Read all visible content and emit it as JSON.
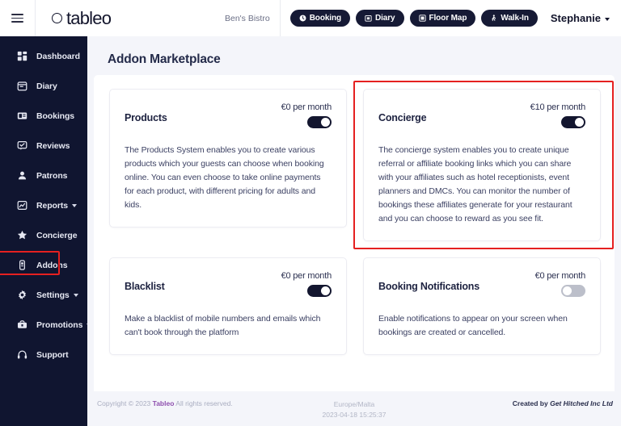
{
  "topbar": {
    "menu_icon": "hamburger-icon",
    "brand": "tableo",
    "venue": "Ben's Bistro",
    "actions": [
      {
        "label": "Booking",
        "icon": "clock-icon"
      },
      {
        "label": "Diary",
        "icon": "calendar-icon"
      },
      {
        "label": "Floor Map",
        "icon": "map-icon"
      },
      {
        "label": "Walk-In",
        "icon": "walking-icon"
      }
    ],
    "user": "Stephanie"
  },
  "sidebar": {
    "items": [
      {
        "label": "Dashboard",
        "icon": "dashboard-icon",
        "caret": false,
        "highlight": false
      },
      {
        "label": "Diary",
        "icon": "calendar-icon",
        "caret": false,
        "highlight": false
      },
      {
        "label": "Bookings",
        "icon": "bookings-icon",
        "caret": false,
        "highlight": false
      },
      {
        "label": "Reviews",
        "icon": "reviews-icon",
        "caret": false,
        "highlight": false
      },
      {
        "label": "Patrons",
        "icon": "patrons-icon",
        "caret": false,
        "highlight": false
      },
      {
        "label": "Reports",
        "icon": "reports-icon",
        "caret": true,
        "highlight": false
      },
      {
        "label": "Concierge",
        "icon": "star-icon",
        "caret": false,
        "highlight": false
      },
      {
        "label": "Addons",
        "icon": "addons-icon",
        "caret": false,
        "highlight": true
      },
      {
        "label": "Settings",
        "icon": "gear-icon",
        "caret": true,
        "highlight": false
      },
      {
        "label": "Promotions",
        "icon": "promotions-icon",
        "caret": true,
        "highlight": false
      },
      {
        "label": "Support",
        "icon": "headset-icon",
        "caret": false,
        "highlight": false
      }
    ]
  },
  "main": {
    "page_title": "Addon Marketplace",
    "cards": [
      {
        "title": "Products",
        "price": "€0 per month",
        "toggle": "on",
        "description": "The Products System enables you to create various products which your guests can choose when booking online. You can even choose to take online payments for each product, with different pricing for adults and kids.",
        "highlight": false
      },
      {
        "title": "Concierge",
        "price": "€10 per month",
        "toggle": "on",
        "description": "The concierge system enables you to create unique referral or affiliate booking links which you can share with your affiliates such as hotel receptionists, event planners and DMCs. You can monitor the number of bookings these affiliates generate for your restaurant and you can choose to reward as you see fit.",
        "highlight": true
      },
      {
        "title": "Blacklist",
        "price": "€0 per month",
        "toggle": "on",
        "description": "Make a blacklist of mobile numbers and emails which can't book through the platform",
        "highlight": false
      },
      {
        "title": "Booking Notifications",
        "price": "€0 per month",
        "toggle": "off",
        "description": "Enable notifications to appear on your screen when bookings are created or cancelled.",
        "highlight": false
      }
    ]
  },
  "footer": {
    "copyright_pre": "Copyright © 2023 ",
    "copyright_brand": "Tableo",
    "copyright_post": " All rights reserved.",
    "timezone": "Europe/Malta",
    "timestamp": "2023-04-18 15:25:37",
    "credit_pre": "Created by ",
    "credit_company": "Get Hitched Inc Ltd"
  },
  "colors": {
    "sidebar_bg": "#101530",
    "page_bg": "#f4f5fa",
    "accent_dark": "#13162f",
    "highlight_red": "#e52020",
    "brand_purple": "#8e4fae"
  }
}
